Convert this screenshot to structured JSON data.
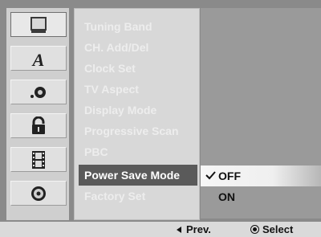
{
  "menu": {
    "items": [
      {
        "label": "Tuning Band"
      },
      {
        "label": "CH. Add/Del"
      },
      {
        "label": "Clock Set"
      },
      {
        "label": "TV Aspect"
      },
      {
        "label": "Display Mode"
      },
      {
        "label": "Progressive Scan"
      },
      {
        "label": "PBC"
      },
      {
        "label": "Power Save Mode"
      },
      {
        "label": "Factory Set"
      }
    ],
    "selected_label": "Power Save Mode"
  },
  "options": {
    "items": [
      {
        "label": "OFF",
        "checked": true
      },
      {
        "label": "ON",
        "checked": false
      }
    ]
  },
  "categories": [
    {
      "icon": "monitor-icon",
      "active": true
    },
    {
      "icon": "language-a-icon",
      "active": false
    },
    {
      "icon": "audio-icon",
      "active": false
    },
    {
      "icon": "lock-icon",
      "active": false
    },
    {
      "icon": "film-icon",
      "active": false
    },
    {
      "icon": "disc-icon",
      "active": false
    }
  ],
  "footer": {
    "prev_label": "Prev.",
    "select_label": "Select"
  },
  "colors": {
    "background": "#8a8a8a",
    "menu_panel": "#d8d8d8",
    "menu_text": "#ededed",
    "selected_bg": "#5a5a5a",
    "option_panel": "#9a9a9a",
    "footer_bg": "#dadada"
  }
}
